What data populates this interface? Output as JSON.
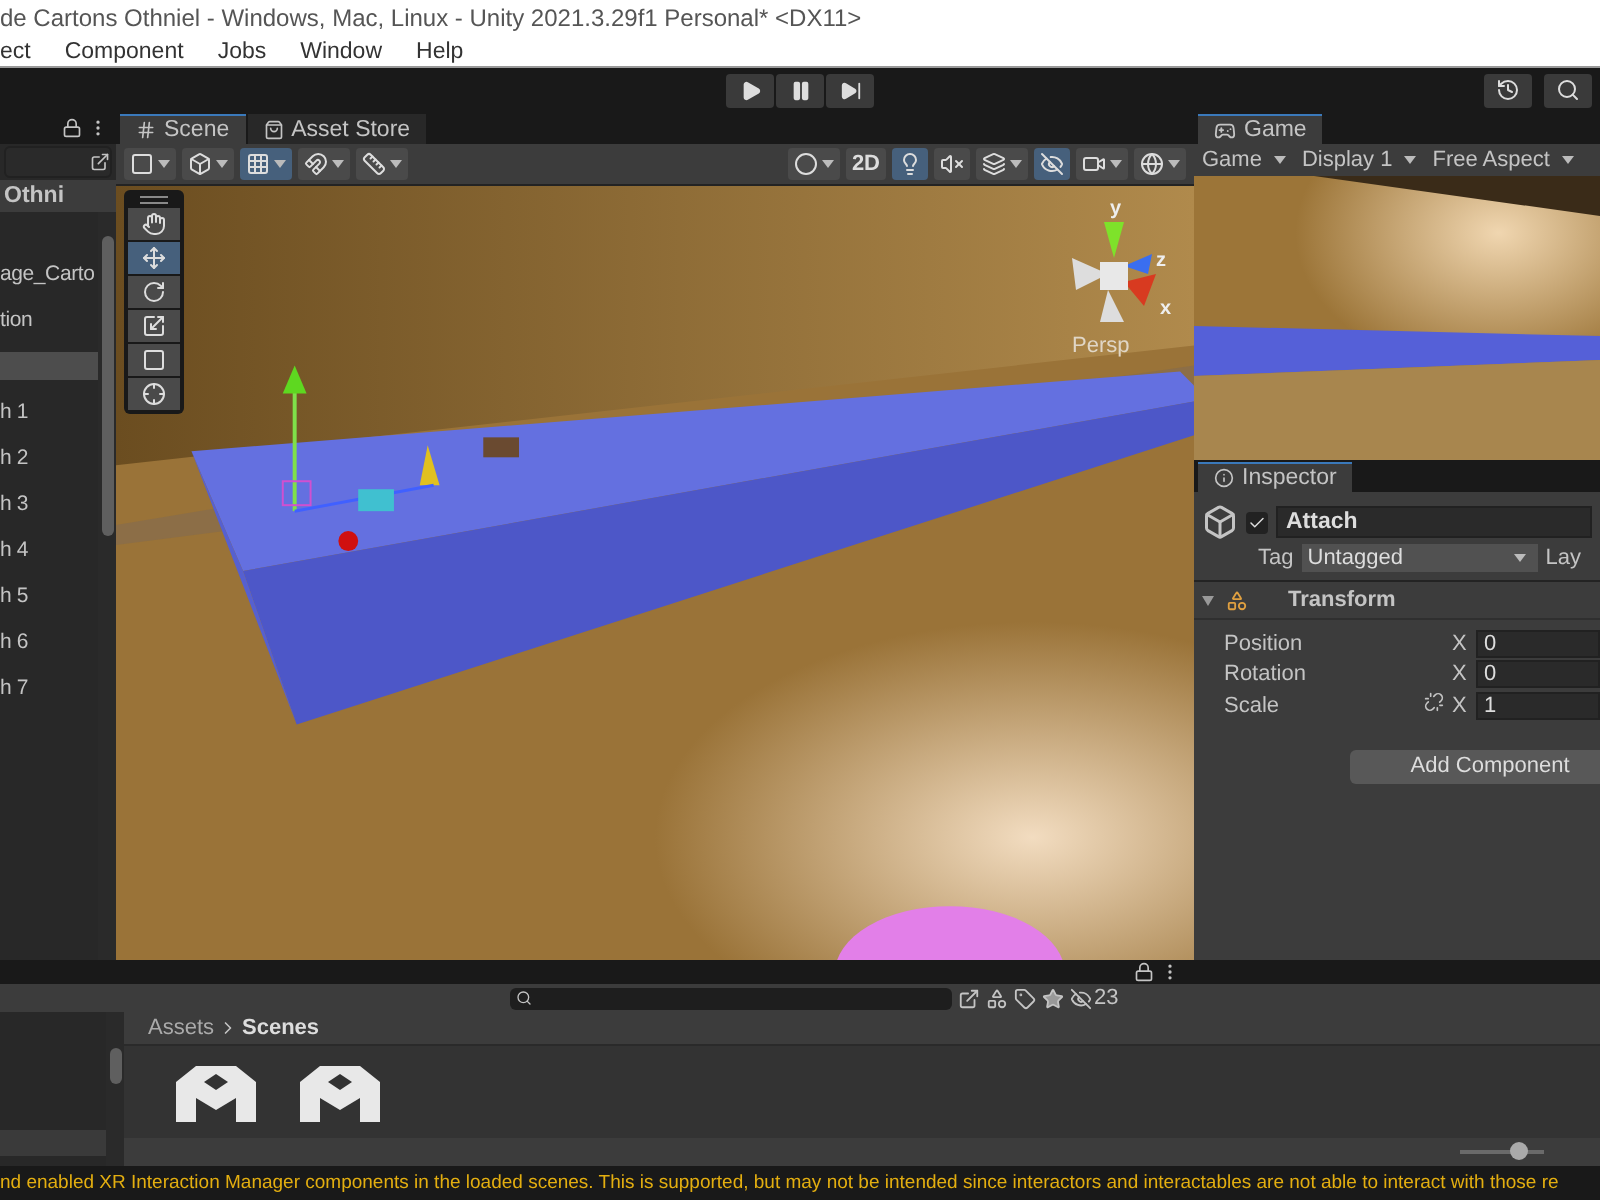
{
  "window": {
    "title": "de Cartons Othniel - Windows, Mac, Linux - Unity 2021.3.29f1 Personal* <DX11>"
  },
  "menu": [
    "ect",
    "Component",
    "Jobs",
    "Window",
    "Help"
  ],
  "hierarchy": {
    "scene_name": "Othni",
    "items": [
      {
        "label": "age_Carto",
        "selected": false
      },
      {
        "label": "tion",
        "selected": false
      },
      {
        "selected": true
      },
      {
        "label": "h 1",
        "selected": false
      },
      {
        "label": "h 2",
        "selected": false
      },
      {
        "label": "h 3",
        "selected": false
      },
      {
        "label": "h 4",
        "selected": false
      },
      {
        "label": "h 5",
        "selected": false
      },
      {
        "label": "h 6",
        "selected": false
      },
      {
        "label": "h 7",
        "selected": false
      }
    ]
  },
  "scene_view": {
    "tabs": [
      {
        "label": "Scene",
        "kind": "scene",
        "selected": true
      },
      {
        "label": "Asset Store",
        "kind": "store",
        "selected": false
      }
    ],
    "left_buttons": [
      {
        "kind": "draw_mode",
        "on": false,
        "dropdown": true
      },
      {
        "kind": "view_options",
        "on": false,
        "dropdown": true
      },
      {
        "kind": "grid",
        "on": true,
        "dropdown": true
      },
      {
        "kind": "snap",
        "on": false,
        "dropdown": true
      },
      {
        "kind": "increment",
        "on": false,
        "dropdown": true
      }
    ],
    "right_buttons": [
      {
        "kind": "shading",
        "on": false,
        "dropdown": true
      },
      {
        "kind": "toggle_2d",
        "label": "2D",
        "on": false,
        "dropdown": false
      },
      {
        "kind": "lighting",
        "on": true,
        "dropdown": false
      },
      {
        "kind": "audio",
        "on": false,
        "dropdown": false
      },
      {
        "kind": "effects",
        "on": false,
        "dropdown": true
      },
      {
        "kind": "visibility",
        "on": true,
        "dropdown": false
      },
      {
        "kind": "camera",
        "on": false,
        "dropdown": true
      },
      {
        "kind": "gizmos",
        "on": false,
        "dropdown": true
      }
    ],
    "tools": [
      {
        "kind": "hand",
        "selected": false
      },
      {
        "kind": "move",
        "selected": true
      },
      {
        "kind": "rotate",
        "selected": false
      },
      {
        "kind": "scale",
        "selected": false
      },
      {
        "kind": "rect",
        "selected": false
      },
      {
        "kind": "transform",
        "selected": false
      }
    ],
    "axis_labels": [
      "y",
      "z",
      "x"
    ],
    "camera_label": "Persp"
  },
  "game_view": {
    "tab": "Game",
    "dropdowns": [
      "Game",
      "Display 1",
      "Free Aspect"
    ]
  },
  "inspector": {
    "tab": "Inspector",
    "active": true,
    "name": "Attach",
    "tag_label": "Tag",
    "tag": "Untagged",
    "layer_label": "Lay",
    "component": {
      "title": "Transform",
      "expanded": true,
      "rows": [
        {
          "label": "Position",
          "axis": "X",
          "value": "0",
          "constrain_icon": false
        },
        {
          "label": "Rotation",
          "axis": "X",
          "value": "0",
          "constrain_icon": false
        },
        {
          "label": "Scale",
          "axis": "X",
          "value": "1",
          "constrain_icon": true
        }
      ]
    },
    "add_button": "Add Component"
  },
  "project": {
    "hidden_count": "23",
    "breadcrumb": [
      {
        "label": "Assets",
        "current": false
      },
      {
        "label": "Scenes",
        "current": true
      }
    ],
    "assets": [
      {
        "kind": "scene"
      },
      {
        "kind": "scene"
      }
    ],
    "zoom": {
      "level": 0.7
    }
  },
  "status_bar": {
    "message": "nd enabled XR Interaction Manager components in the loaded scenes. This is supported, but may not be intended since interactors and interactables are not able to interact with those re"
  }
}
